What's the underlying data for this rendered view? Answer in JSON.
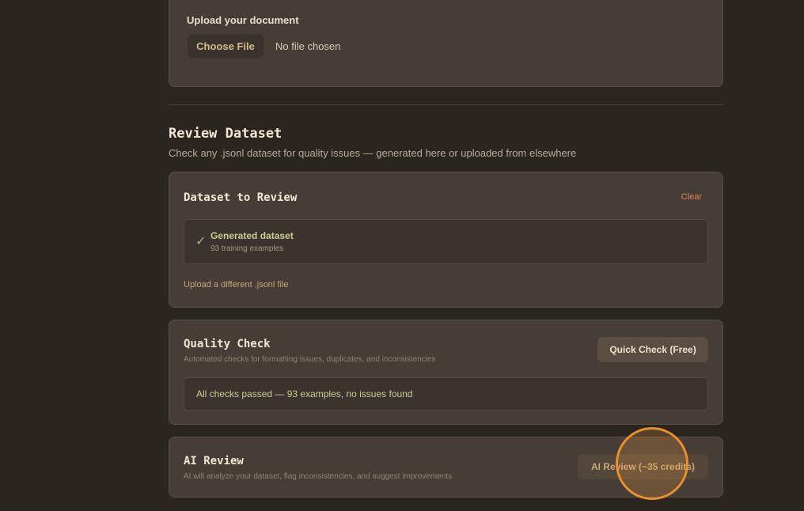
{
  "upload": {
    "label": "Upload your document",
    "choose_button": "Choose File",
    "status": "No file chosen"
  },
  "review": {
    "title": "Review Dataset",
    "subtitle": "Check any .jsonl dataset for quality issues — generated here or uploaded from elsewhere"
  },
  "dataset_card": {
    "title": "Dataset to Review",
    "clear_label": "Clear",
    "check_glyph": "✓",
    "dataset_name": "Generated dataset",
    "dataset_count": "93 training examples",
    "upload_different": "Upload a different .jsonl file"
  },
  "quality_card": {
    "title": "Quality Check",
    "description": "Automated checks for formatting issues, duplicates, and inconsistencies",
    "button": "Quick Check (Free)",
    "result": "All checks passed — 93 examples, no issues found"
  },
  "ai_card": {
    "title": "AI Review",
    "description": "AI will analyze your dataset, flag inconsistencies, and suggest improvements",
    "button": "AI Review (~35 credits)"
  },
  "colors": {
    "background": "#2b2520",
    "card": "#463d36",
    "accent_orange": "#e8902c",
    "success_text": "#c9cc94",
    "clear_link": "#d98855"
  }
}
